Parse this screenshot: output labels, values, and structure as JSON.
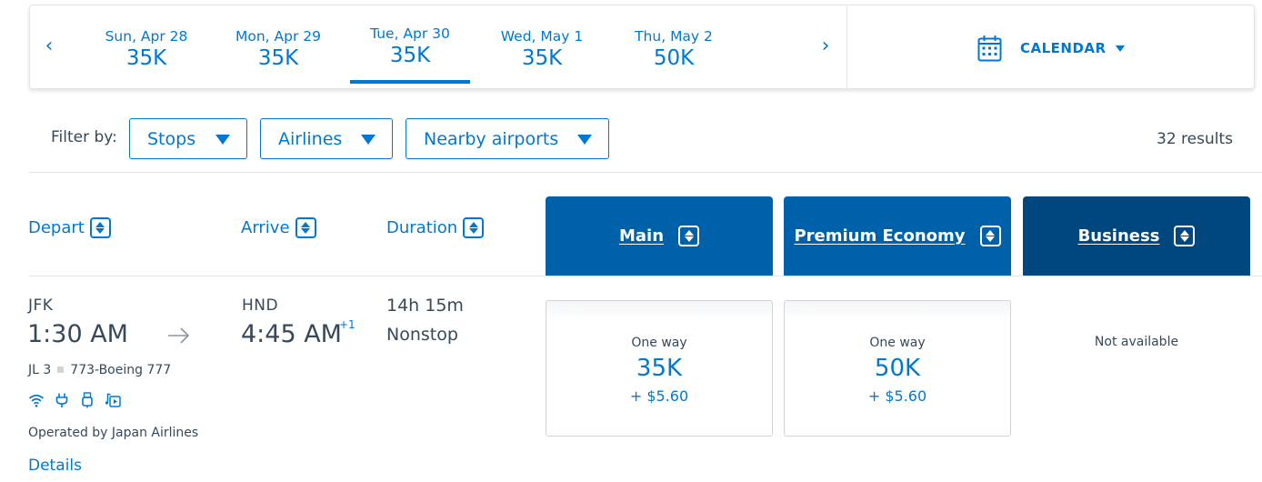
{
  "date_strip": {
    "prev_arrow": "‹",
    "next_arrow": "›",
    "dates": [
      {
        "label": "Sun, Apr 28",
        "price": "35K"
      },
      {
        "label": "Mon, Apr 29",
        "price": "35K"
      },
      {
        "label": "Tue, Apr 30",
        "price": "35K",
        "selected": true
      },
      {
        "label": "Wed, May 1",
        "price": "35K"
      },
      {
        "label": "Thu, May 2",
        "price": "50K"
      }
    ],
    "calendar_label": "CALENDAR"
  },
  "filters": {
    "label": "Filter by:",
    "buttons": [
      "Stops",
      "Airlines",
      "Nearby airports"
    ],
    "results": "32 results"
  },
  "columns": {
    "depart": "Depart",
    "arrive": "Arrive",
    "duration": "Duration",
    "cabins": [
      "Main",
      "Premium Economy",
      "Business"
    ]
  },
  "flight": {
    "depart_airport": "JFK",
    "depart_time": "1:30 AM",
    "arrive_airport": "HND",
    "arrive_time": "4:45 AM",
    "day_offset": "+1",
    "duration": "14h 15m",
    "stops": "Nonstop",
    "flight_number": "JL 3",
    "aircraft": "773-Boeing 777",
    "amenities": [
      "wifi-icon",
      "power-outlet-icon",
      "usb-icon",
      "entertainment-icon"
    ],
    "operated_by": "Operated by Japan Airlines",
    "details_link": "Details",
    "fares": {
      "main": {
        "type": "One way",
        "miles": "35K",
        "tax": "+ $5.60"
      },
      "premium": {
        "type": "One way",
        "miles": "50K",
        "tax": "+ $5.60"
      },
      "business": {
        "status": "Not available"
      }
    }
  },
  "colors": {
    "accent": "#0078d2",
    "cabin_header": "#0061ab",
    "business_header": "#00467f",
    "text": "#36495a"
  }
}
